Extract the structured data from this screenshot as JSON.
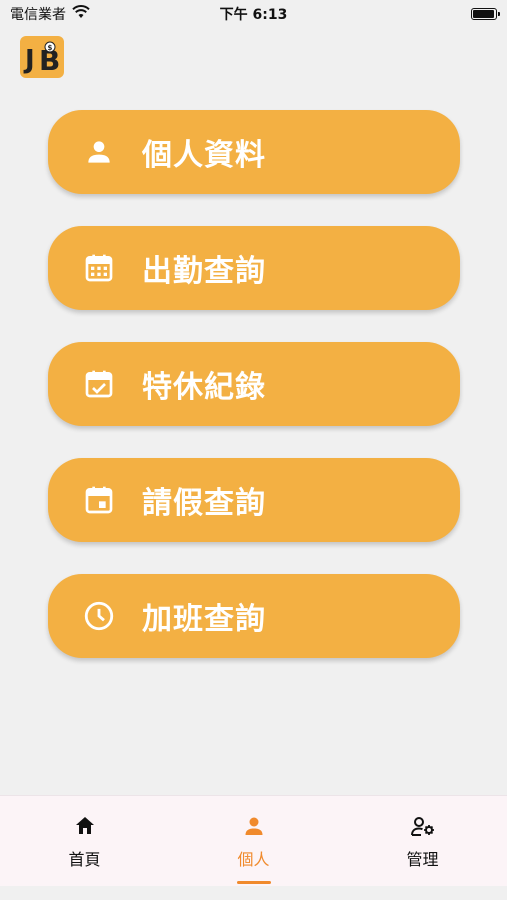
{
  "status_bar": {
    "carrier": "電信業者",
    "time": "下午 6:13",
    "battery_level": 0.95
  },
  "app": {
    "logo_icon": "jb-logo-icon"
  },
  "menu": {
    "items": [
      {
        "label": "個人資料",
        "icon": "person-icon"
      },
      {
        "label": "出勤查詢",
        "icon": "calendar-grid-icon"
      },
      {
        "label": "特休紀錄",
        "icon": "calendar-check-icon"
      },
      {
        "label": "請假查詢",
        "icon": "calendar-event-icon"
      },
      {
        "label": "加班查詢",
        "icon": "clock-icon"
      }
    ]
  },
  "tab_bar": {
    "tabs": [
      {
        "label": "首頁",
        "icon": "home-icon"
      },
      {
        "label": "個人",
        "icon": "person-icon",
        "active": true
      },
      {
        "label": "管理",
        "icon": "person-gear-icon"
      }
    ]
  },
  "colors": {
    "accent": "#f3b043",
    "active_tab": "#f08a2c",
    "background": "#f0f0f0"
  }
}
